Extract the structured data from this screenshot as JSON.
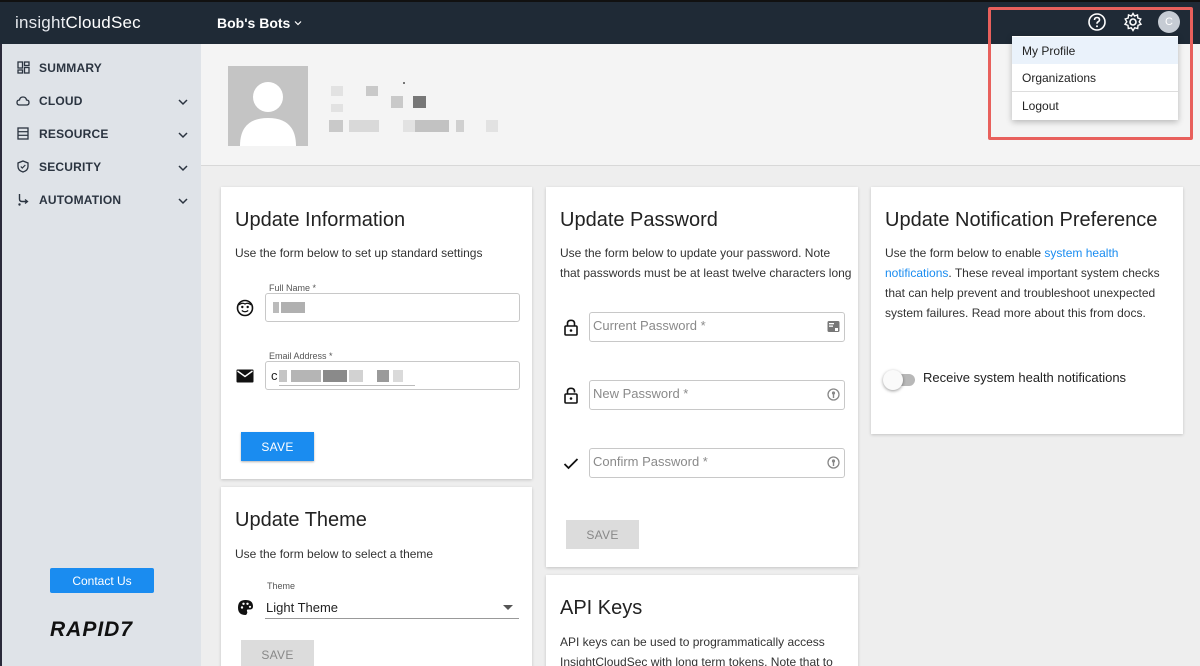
{
  "topbar": {
    "brand_light": "insight",
    "brand_bold": "CloudSec",
    "org_name": "Bob's Bots",
    "avatar_initial": "C"
  },
  "sidebar": {
    "items": [
      {
        "label": "SUMMARY",
        "icon": "dashboard-icon"
      },
      {
        "label": "CLOUD",
        "icon": "cloud-icon"
      },
      {
        "label": "RESOURCE",
        "icon": "list-icon"
      },
      {
        "label": "SECURITY",
        "icon": "shield-icon"
      },
      {
        "label": "AUTOMATION",
        "icon": "branch-icon"
      }
    ],
    "contact_label": "Contact Us",
    "logo_text": "RAPID7"
  },
  "dropdown": {
    "items": [
      "My Profile",
      "Organizations",
      "Logout"
    ]
  },
  "update_info": {
    "title": "Update Information",
    "desc": "Use the form below to set up standard settings",
    "full_name_label": "Full Name *",
    "email_label": "Email Address *",
    "email_value_prefix": "c",
    "save_label": "SAVE"
  },
  "update_theme": {
    "title": "Update Theme",
    "desc": "Use the form below to select a theme",
    "theme_label": "Theme",
    "theme_value": "Light Theme",
    "save_label": "SAVE"
  },
  "update_password": {
    "title": "Update Password",
    "desc_line1": "Use the form below to update your password. Note",
    "desc_line2": "that passwords must be at least twelve characters long",
    "current_placeholder": "Current Password *",
    "new_placeholder": "New Password *",
    "confirm_placeholder": "Confirm Password *",
    "save_label": "SAVE"
  },
  "api_keys": {
    "title": "API Keys",
    "desc_line1": "API keys can be used to programmatically access",
    "desc_line2": "InsightCloudSec with long term tokens. Note that to"
  },
  "notifications": {
    "title": "Update Notification Preference",
    "desc_pre": "Use the form below to enable ",
    "desc_link1": "system health",
    "desc_link2": "notifications",
    "desc_post1": ". These reveal important system checks",
    "desc_line3": "that can help prevent and troubleshoot unexpected",
    "desc_line4": "system failures. Read more about this from docs.",
    "toggle_label": "Receive system health notifications"
  }
}
